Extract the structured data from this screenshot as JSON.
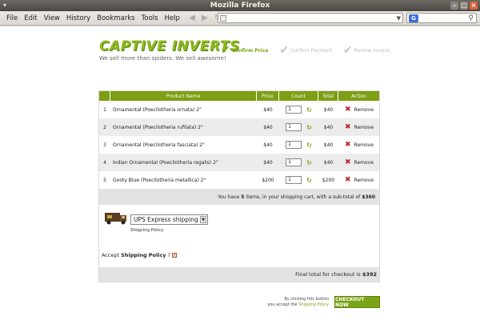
{
  "window": {
    "title": "Mozilla Firefox"
  },
  "menu": [
    "File",
    "Edit",
    "View",
    "History",
    "Bookmarks",
    "Tools",
    "Help"
  ],
  "urlbar": {
    "value": ""
  },
  "page": {
    "logo": "CAPTIVE INVERTS",
    "tagline": "We sell more than spiders. We sell awesome!",
    "steps": [
      {
        "label": "Confirm Price",
        "active": true
      },
      {
        "label": "Confirm Payment",
        "active": false
      },
      {
        "label": "Review Invoice",
        "active": false
      }
    ],
    "table": {
      "headers": {
        "product": "Product Name",
        "price": "Price",
        "count": "Count",
        "total": "Total",
        "action": "Action"
      },
      "rows": [
        {
          "idx": "1",
          "name": "Ornamental (Poecilotheria ornata) 2\"",
          "price": "$40",
          "qty": "1",
          "total": "$40",
          "action": "Remove"
        },
        {
          "idx": "2",
          "name": "Ornamental (Poecilotheria rufilata) 2\"",
          "price": "$40",
          "qty": "1",
          "total": "$40",
          "action": "Remove"
        },
        {
          "idx": "3",
          "name": "Ornamental (Poecilotheria fasciata) 2\"",
          "price": "$40",
          "qty": "1",
          "total": "$40",
          "action": "Remove"
        },
        {
          "idx": "4",
          "name": "Indian Ornamental (Poecilotheria regalis) 2\"",
          "price": "$40",
          "qty": "1",
          "total": "$40",
          "action": "Remove"
        },
        {
          "idx": "5",
          "name": "Gooty Blue (Poecilotheria metallica) 2\"",
          "price": "$200",
          "qty": "1",
          "total": "$200",
          "action": "Remove"
        }
      ]
    },
    "subtotal": {
      "prefix": "You have",
      "count": "5",
      "middle": "items, in your shopping cart, with a sub-total of",
      "amount": "$360"
    },
    "shipping": {
      "selected": "UPS Express shipping",
      "policy_link": "Shipping Policy"
    },
    "accept": {
      "prefix": "Accept",
      "bold": "Shipping Policy",
      "suffix": "?"
    },
    "final": {
      "label": "Final total for checkout is",
      "amount": "$392"
    },
    "checkout_note": {
      "line1": "By clicking this button",
      "line2_prefix": "you accept the",
      "line2_link": "Shipping Policy"
    },
    "checkout_button": "CHECKOUT NOW"
  }
}
